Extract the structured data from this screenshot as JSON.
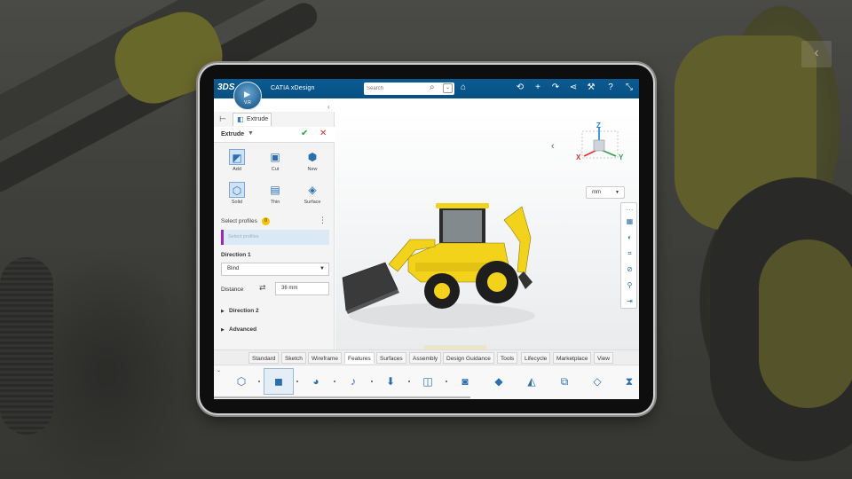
{
  "app": {
    "title": "CATIA xDesign",
    "brand_logo": "3DS",
    "compass_version": "V.R",
    "accent_color": "#0a5b93"
  },
  "search": {
    "placeholder": "Search",
    "icon": "search-icon"
  },
  "topbar_icons": [
    "tag-icon",
    "share-icon",
    "plus-icon",
    "forward-icon",
    "network-icon",
    "tools-icon",
    "help-icon",
    "collapse-icon"
  ],
  "panel": {
    "tab_label": "Extrude",
    "command_title": "Extrude",
    "operations": [
      {
        "label": "Add",
        "icon": "add-extrude-icon",
        "selected": true
      },
      {
        "label": "Cut",
        "icon": "cut-extrude-icon",
        "selected": false
      },
      {
        "label": "New",
        "icon": "new-body-icon",
        "selected": false
      }
    ],
    "shapes": [
      {
        "label": "Solid",
        "icon": "solid-icon",
        "selected": true
      },
      {
        "label": "Thin",
        "icon": "thin-icon",
        "selected": false
      },
      {
        "label": "Surface",
        "icon": "surface-icon",
        "selected": false
      }
    ],
    "select_profiles_label": "Select profiles",
    "select_profiles_count": "0",
    "select_profiles_placeholder": "Select profiles",
    "direction1_title": "Direction 1",
    "direction1_value": "Blind",
    "distance_label": "Distance",
    "distance_value": "36 mm",
    "direction2_title": "Direction 2",
    "advanced_title": "Advanced",
    "ok_color": "#2ea043",
    "cancel_color": "#d0342c"
  },
  "viewport": {
    "units": "mm",
    "axes": {
      "x": "X",
      "y": "Y",
      "z": "Z"
    },
    "axis_colors": {
      "x": "#e03131",
      "y": "#2f9e44",
      "z": "#1c7ed6"
    },
    "model_color": "#f2d21a"
  },
  "ribbon": {
    "tabs": [
      "Standard",
      "Sketch",
      "Wireframe",
      "Features",
      "Surfaces",
      "Assembly",
      "Design Guidance",
      "Tools",
      "Lifecycle",
      "Marketplace",
      "View"
    ],
    "active_tab": "Features",
    "tools": [
      "box-icon",
      "extrude-icon",
      "revolve-icon",
      "sweep-icon",
      "pocket-icon",
      "shell-icon",
      "fillet-icon",
      "chamfer-icon",
      "draft-icon",
      "pattern-icon",
      "mirror-icon",
      "split-icon"
    ]
  }
}
